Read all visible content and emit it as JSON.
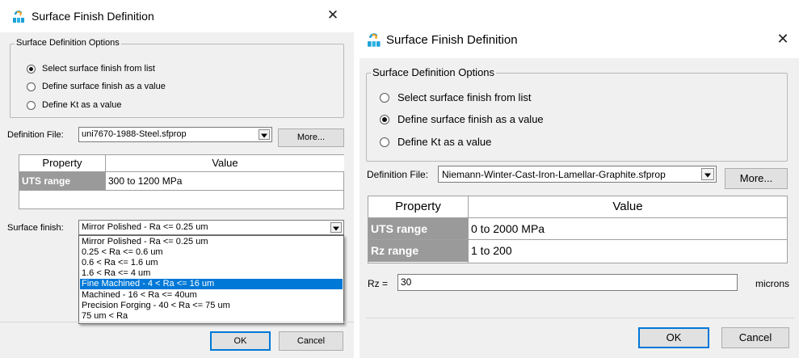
{
  "left": {
    "title": "Surface Finish Definition",
    "close": "✕",
    "group_title": "Surface Definition Options",
    "radios": [
      {
        "label": "Select surface finish from list",
        "selected": true
      },
      {
        "label": "Define surface finish as a value",
        "selected": false
      },
      {
        "label": "Define Kt as a value",
        "selected": false
      }
    ],
    "definition_file_label": "Definition File:",
    "definition_file_value": "uni7670-1988-Steel.sfprop",
    "more_button": "More...",
    "table": {
      "headers": [
        "Property",
        "Value"
      ],
      "rows": [
        {
          "property": "UTS range",
          "value": "300 to 1200 MPa"
        }
      ]
    },
    "surface_finish_label": "Surface finish:",
    "surface_finish_value": "Mirror Polished - Ra <= 0.25 um",
    "dropdown_items": [
      "Mirror Polished - Ra <= 0.25 um",
      "0.25 < Ra <= 0.6 um",
      "0.6 < Ra <= 1.6 um",
      "1.6 < Ra <= 4 um",
      "Fine Machined - 4 < Ra <= 16 um",
      "Machined - 16 < Ra <= 40um",
      "Precision Forging - 40 < Ra <= 75 um",
      "75 um < Ra"
    ],
    "dropdown_highlighted_index": 4,
    "ok_button": "OK",
    "cancel_button": "Cancel"
  },
  "right": {
    "title": "Surface Finish Definition",
    "close": "✕",
    "group_title": "Surface Definition Options",
    "radios": [
      {
        "label": "Select surface finish from list",
        "selected": false
      },
      {
        "label": "Define surface finish as a value",
        "selected": true
      },
      {
        "label": "Define Kt as a value",
        "selected": false
      }
    ],
    "definition_file_label": "Definition File:",
    "definition_file_value": "Niemann-Winter-Cast-Iron-Lamellar-Graphite.sfprop",
    "more_button": "More...",
    "table": {
      "headers": [
        "Property",
        "Value"
      ],
      "rows": [
        {
          "property": "UTS range",
          "value": "0 to 2000 MPa"
        },
        {
          "property": "Rz range",
          "value": "1 to 200"
        }
      ]
    },
    "rz_label": "Rz =",
    "rz_value": "30",
    "rz_unit": "microns",
    "ok_button": "OK",
    "cancel_button": "Cancel"
  }
}
